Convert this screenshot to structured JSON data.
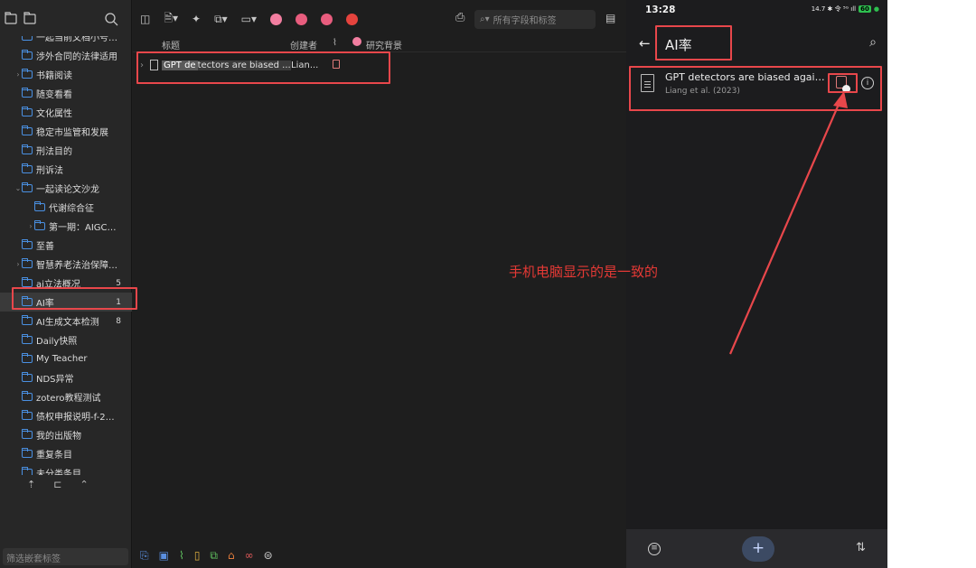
{
  "desktop": {
    "collections": [
      {
        "label": "一起当前文档小号起...",
        "twisty": "",
        "count": "",
        "level": 0
      },
      {
        "label": "涉外合同的法律适用",
        "twisty": "",
        "count": "",
        "level": 0
      },
      {
        "label": "书籍阅读",
        "twisty": "›",
        "count": "",
        "level": 0
      },
      {
        "label": "随变看看",
        "twisty": "",
        "count": "",
        "level": 0
      },
      {
        "label": "文化属性",
        "twisty": "",
        "count": "",
        "level": 0
      },
      {
        "label": "稳定市监管和发展",
        "twisty": "",
        "count": "",
        "level": 0
      },
      {
        "label": "刑法目的",
        "twisty": "",
        "count": "",
        "level": 0
      },
      {
        "label": "刑诉法",
        "twisty": "",
        "count": "",
        "level": 0
      },
      {
        "label": "一起读论文沙龙",
        "twisty": "⌄",
        "count": "",
        "level": 0
      },
      {
        "label": "代谢综合征",
        "twisty": "",
        "count": "",
        "level": 1
      },
      {
        "label": "第一期：AIGC版...",
        "twisty": "›",
        "count": "",
        "level": 1
      },
      {
        "label": "至善",
        "twisty": "",
        "count": "",
        "level": 0
      },
      {
        "label": "智慧养老法治保障研...",
        "twisty": "›",
        "count": "",
        "level": 0
      },
      {
        "label": "ai立法概况",
        "twisty": "",
        "count": "5",
        "level": 0
      },
      {
        "label": "AI率",
        "twisty": "",
        "count": "1",
        "level": 0,
        "selected": true
      },
      {
        "label": "AI生成文本检测",
        "twisty": "",
        "count": "8",
        "level": 0
      },
      {
        "label": "Daily快照",
        "twisty": "",
        "count": "",
        "level": 0
      },
      {
        "label": "My Teacher",
        "twisty": "",
        "count": "",
        "level": 0
      },
      {
        "label": "NDS异常",
        "twisty": "",
        "count": "",
        "level": 0
      },
      {
        "label": "zotero教程测试",
        "twisty": "",
        "count": "",
        "level": 0
      },
      {
        "label": "债权申报说明-f-202...",
        "twisty": "",
        "count": "",
        "level": 0
      },
      {
        "label": "我的出版物",
        "twisty": "",
        "count": "",
        "level": 0
      },
      {
        "label": "重复条目",
        "twisty": "",
        "count": "",
        "level": 0
      },
      {
        "label": "未分类条目",
        "twisty": "",
        "count": "",
        "level": 0
      }
    ],
    "tag_filter_placeholder": "筛选嵌套标签",
    "search_placeholder": "所有字段和标签",
    "columns": {
      "title": "标题",
      "creator": "创建者",
      "tag": "研究背景"
    },
    "item": {
      "title_highlight": "GPT de",
      "title_rest": "tectors are biased ...",
      "creator": "Lian..."
    },
    "tag_colors": [
      "#f27ea0",
      "#e85d7e",
      "#e85d7e",
      "#e5433d"
    ]
  },
  "phone": {
    "time": "13:28",
    "status_icons": "14.7 ✱ 令 ⁵ᴳ ıll",
    "battery": "60",
    "title": "AI率",
    "item_title": "GPT detectors are biased against non-native English writers",
    "item_sub": "Liang et al. (2023)",
    "add_label": "+",
    "sort_label": "⇅"
  },
  "annotation": {
    "text": "手机电脑显示的是一致的",
    "color": "#e53935"
  }
}
